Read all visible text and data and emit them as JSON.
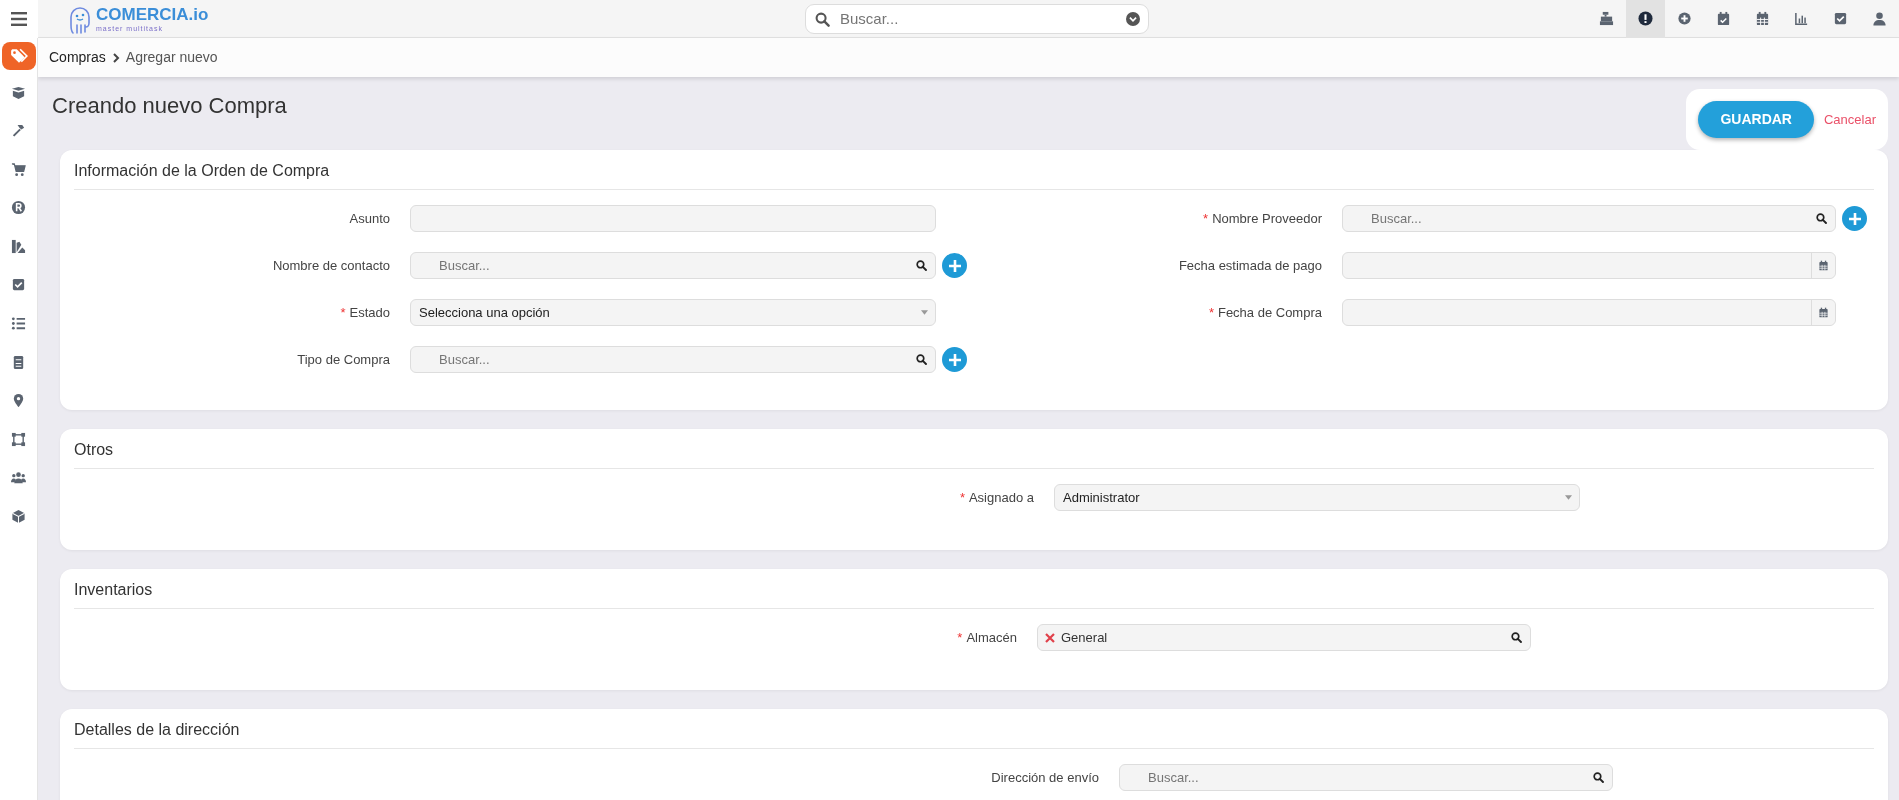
{
  "topbar": {
    "logo": {
      "name": "COMERCIA.io",
      "tagline": "master multitask"
    },
    "search": {
      "placeholder": "Buscar..."
    },
    "icons": [
      {
        "kind": "cash-register",
        "selected": false
      },
      {
        "kind": "alert",
        "selected": true
      },
      {
        "kind": "plus-circle",
        "selected": false
      },
      {
        "kind": "calendar-check",
        "selected": false
      },
      {
        "kind": "calendar",
        "selected": false
      },
      {
        "kind": "chart",
        "selected": false
      },
      {
        "kind": "checkbox",
        "selected": false
      },
      {
        "kind": "user",
        "selected": false
      }
    ]
  },
  "sidebar": {
    "items": [
      {
        "kind": "tags",
        "selected": true
      },
      {
        "kind": "box",
        "selected": false
      },
      {
        "kind": "hammer",
        "selected": false
      },
      {
        "kind": "cart",
        "selected": false
      },
      {
        "kind": "registered",
        "selected": false
      },
      {
        "kind": "swatch",
        "selected": false
      },
      {
        "kind": "checkbox",
        "selected": false
      },
      {
        "kind": "list",
        "selected": false
      },
      {
        "kind": "cabinet",
        "selected": false
      },
      {
        "kind": "pin",
        "selected": false
      },
      {
        "kind": "vector",
        "selected": false
      },
      {
        "kind": "users",
        "selected": false
      },
      {
        "kind": "cube",
        "selected": false
      }
    ]
  },
  "breadcrumb": [
    "Compras",
    "Agregar nuevo"
  ],
  "title": "Creando nuevo Compra",
  "actions": {
    "save": "GUARDAR",
    "cancel": "Cancelar"
  },
  "sections": [
    {
      "title": "Información de la Orden de Compra",
      "columns": [
        [
          {
            "label": "Asunto",
            "kind": "text"
          },
          {
            "label": "Nombre de contacto",
            "kind": "lookup",
            "placeholder": "Buscar...",
            "add_button": true
          },
          {
            "required_mark": "*",
            "label": "Estado",
            "kind": "select",
            "value": "Selecciona una opción"
          },
          {
            "label": "Tipo de Compra",
            "kind": "lookup",
            "placeholder": "Buscar...",
            "add_button": true
          }
        ],
        [
          {
            "required_mark": "*",
            "label": "Nombre Proveedor",
            "kind": "lookup",
            "placeholder": "Buscar...",
            "add_button": true
          },
          {
            "label": "Fecha estimada de pago",
            "kind": "date"
          },
          {
            "required_mark": "*",
            "label": "Fecha de Compra",
            "kind": "date"
          }
        ]
      ]
    },
    {
      "title": "Otros",
      "columns": [
        [
          {
            "required_mark": "*",
            "label": "Asignado a",
            "kind": "select",
            "value": "Administrator"
          }
        ]
      ]
    },
    {
      "title": "Inventarios",
      "columns": [
        [
          {
            "required_mark": "*",
            "label": "Almacén",
            "kind": "tag-lookup",
            "tags": [
              "General"
            ]
          }
        ]
      ]
    },
    {
      "title": "Detalles de la dirección",
      "columns": [
        [
          {
            "label": "Dirección de envío",
            "kind": "lookup",
            "placeholder": "Buscar..."
          }
        ]
      ]
    }
  ]
}
